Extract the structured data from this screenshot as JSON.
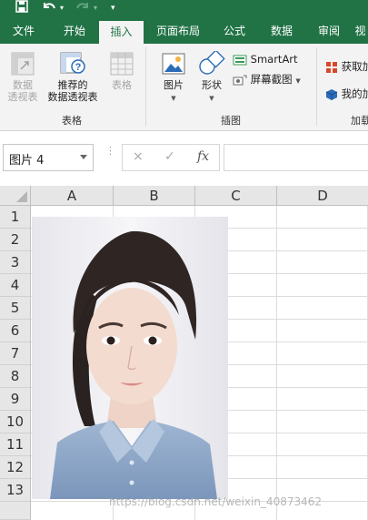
{
  "quick_access": {
    "save_icon": "save-icon",
    "undo_icon": "undo-icon",
    "redo_icon": "redo-icon",
    "customize_icon": "customize-quick-access-icon"
  },
  "tabs": [
    {
      "label": "文件"
    },
    {
      "label": "开始"
    },
    {
      "label": "插入",
      "active": true
    },
    {
      "label": "页面布局"
    },
    {
      "label": "公式"
    },
    {
      "label": "数据"
    },
    {
      "label": "审阅"
    },
    {
      "label": "视"
    }
  ],
  "ribbon": {
    "tables_group": {
      "label": "表格",
      "pivot_table": {
        "line1": "数据",
        "line2": "透视表"
      },
      "recommended_pivot": {
        "line1": "推荐的",
        "line2": "数据透视表"
      },
      "table": {
        "label": "表格"
      }
    },
    "illustrations_group": {
      "label": "插图",
      "pictures": {
        "label": "图片"
      },
      "shapes": {
        "label": "形状"
      },
      "smartart": {
        "label": "SmartArt"
      },
      "screenshot": {
        "label": "屏幕截图"
      }
    },
    "addins_group": {
      "label": "加载",
      "get_addins": {
        "label": "获取加"
      },
      "my_addins": {
        "label": "我的加"
      }
    }
  },
  "formula_bar": {
    "name_box": "图片 4",
    "cancel_icon": "×",
    "enter_icon": "✓",
    "fx_label": "fx",
    "formula_value": ""
  },
  "columns": [
    "A",
    "B",
    "C",
    "D"
  ],
  "rows": [
    "1",
    "2",
    "3",
    "4",
    "5",
    "6",
    "7",
    "8",
    "9",
    "10",
    "11",
    "12",
    "13"
  ],
  "picture": {
    "name": "图片 4",
    "description": "证件照"
  },
  "watermark": "https://blog.csdn.net/weixin_40873462",
  "colors": {
    "accent": "#217346",
    "ribbon_bg": "#f3f3f3",
    "header_bg": "#e6e6e6"
  }
}
